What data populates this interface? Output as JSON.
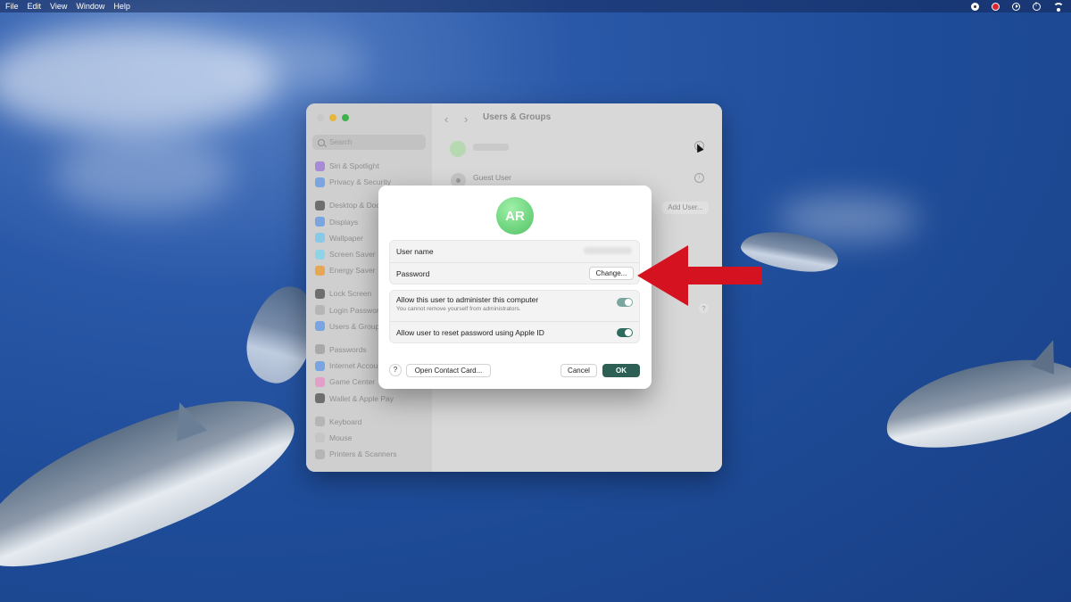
{
  "menubar": {
    "items": [
      "File",
      "Edit",
      "View",
      "Window",
      "Help"
    ]
  },
  "window": {
    "title": "Users & Groups",
    "search_placeholder": "Search",
    "sidebar": [
      {
        "label": "Siri & Spotlight",
        "icon": "siri-icon",
        "color": "#a78bd6"
      },
      {
        "label": "Privacy & Security",
        "icon": "hand-icon",
        "color": "#7aa5e0"
      },
      {
        "gap": true
      },
      {
        "label": "Desktop & Dock",
        "icon": "dock-icon",
        "color": "#6e6e6e"
      },
      {
        "label": "Displays",
        "icon": "display-icon",
        "color": "#7aa5e0"
      },
      {
        "label": "Wallpaper",
        "icon": "wallpaper-icon",
        "color": "#88c9e8"
      },
      {
        "label": "Screen Saver",
        "icon": "screensaver-icon",
        "color": "#8fd3e8"
      },
      {
        "label": "Energy Saver",
        "icon": "battery-icon",
        "color": "#e6a654"
      },
      {
        "gap": true
      },
      {
        "label": "Lock Screen",
        "icon": "lock-icon",
        "color": "#6e6e6e"
      },
      {
        "label": "Login Password",
        "icon": "key-icon",
        "color": "#b5b5b5"
      },
      {
        "label": "Users & Groups",
        "icon": "users-icon",
        "color": "#7aa5e0"
      },
      {
        "gap": true
      },
      {
        "label": "Passwords",
        "icon": "password-icon",
        "color": "#a9a9a9"
      },
      {
        "label": "Internet Accounts",
        "icon": "at-icon",
        "color": "#7aa5e0"
      },
      {
        "label": "Game Center",
        "icon": "gamecenter-icon",
        "color": "#e2a0c8"
      },
      {
        "label": "Wallet & Apple Pay",
        "icon": "wallet-icon",
        "color": "#6e6e6e"
      },
      {
        "gap": true
      },
      {
        "label": "Keyboard",
        "icon": "keyboard-icon",
        "color": "#b5b5b5"
      },
      {
        "label": "Mouse",
        "icon": "mouse-icon",
        "color": "#c5c5c5"
      },
      {
        "label": "Printers & Scanners",
        "icon": "printer-icon",
        "color": "#b5b5b5"
      }
    ],
    "guest_label": "Guest User",
    "add_user_label": "Add User...",
    "help_label": "?"
  },
  "dialog": {
    "initials": "AR",
    "user_name_label": "User name",
    "password_label": "Password",
    "change_button": "Change...",
    "admin_label": "Allow this user to administer this computer",
    "admin_subtext": "You cannot remove yourself from administrators.",
    "admin_enabled": true,
    "reset_label": "Allow user to reset password using Apple ID",
    "reset_enabled": true,
    "help_button": "?",
    "contact_button": "Open Contact Card...",
    "cancel_button": "Cancel",
    "ok_button": "OK",
    "accent_color": "#2d5f55"
  },
  "annotation": {
    "arrow_color": "#d5121f"
  }
}
